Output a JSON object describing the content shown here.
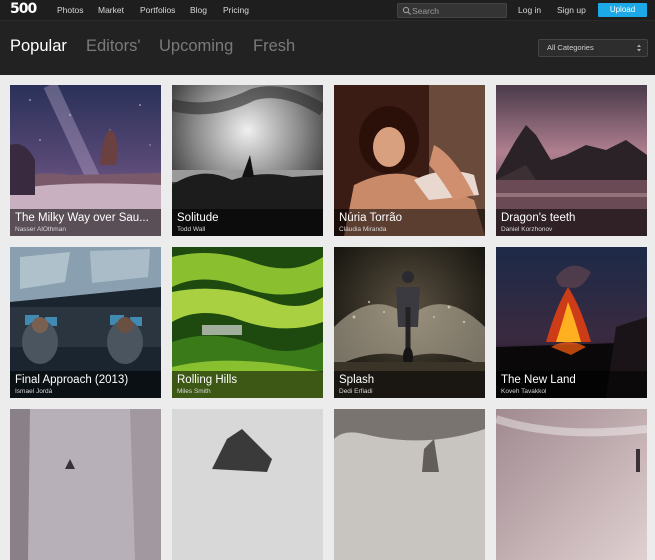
{
  "header": {
    "logo_text": "500",
    "nav": [
      "Photos",
      "Market",
      "Portfolios",
      "Blog",
      "Pricing"
    ],
    "search_placeholder": "Search",
    "login": "Log in",
    "signup": "Sign up",
    "upload": "Upload"
  },
  "tabs": [
    "Popular",
    "Editors'",
    "Upcoming",
    "Fresh"
  ],
  "category_select": "All Categories",
  "photos": [
    {
      "title": "The Milky Way over Sau...",
      "author": "Nasser AlOthman"
    },
    {
      "title": "Solitude",
      "author": "Todd Wall"
    },
    {
      "title": "Núria Torrão",
      "author": "Cláudia Miranda"
    },
    {
      "title": "Dragon's teeth",
      "author": "Daniel Korzhonov"
    },
    {
      "title": "Final Approach (2013)",
      "author": "Ismael Jordá"
    },
    {
      "title": "Rolling Hills",
      "author": "Miles Smith"
    },
    {
      "title": "Splash",
      "author": "Dedi Erfiadi"
    },
    {
      "title": "The New Land",
      "author": "Koveh Tavakkol"
    },
    {
      "title": "",
      "author": ""
    },
    {
      "title": "",
      "author": ""
    },
    {
      "title": "",
      "author": ""
    },
    {
      "title": "",
      "author": ""
    }
  ],
  "colors": {
    "accent": "#1da8e8",
    "header_bg": "#1e1e1e",
    "band_bg": "#222222",
    "page_bg": "#ececec"
  }
}
